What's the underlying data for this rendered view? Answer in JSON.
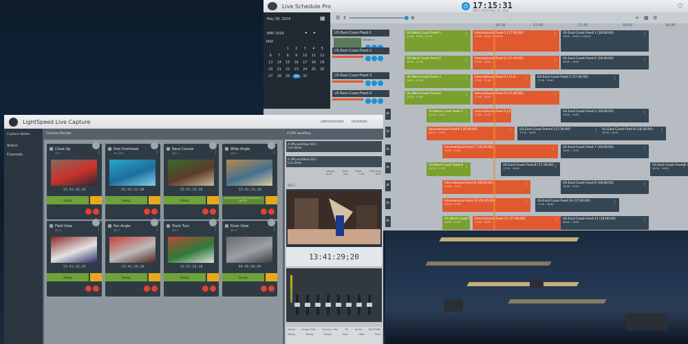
{
  "schedule_window": {
    "app_title": "Live Schedule Pro",
    "clock": "17:15:31",
    "clock_sub": "GMT+05:00   May 30, 2024",
    "side_date": "May 30, 2024",
    "month_label": "MAY 2024",
    "calendar_head": "MAY",
    "calendar_days": [
      "",
      "",
      "1",
      "2",
      "3",
      "4",
      "5",
      "6",
      "7",
      "8",
      "9",
      "10",
      "11",
      "12",
      "13",
      "14",
      "15",
      "16",
      "17",
      "18",
      "19",
      "20",
      "21",
      "22",
      "23",
      "24",
      "25",
      "26",
      "27",
      "28",
      "29",
      "30",
      "31"
    ],
    "selected_day": "30",
    "ticks": [
      "16:30",
      "17:00",
      "17:30",
      "18:00",
      "18:30",
      "19:00"
    ],
    "channels": [
      {
        "name": "US-East-Coast-Feed-1",
        "thumb_label": "Stitched 1"
      },
      {
        "name": "US-East-Coast-Feed-2"
      },
      {
        "name": "US-East-Coast-Feed-3"
      },
      {
        "name": "US-East-Coast-Feed-4"
      }
    ],
    "blocks": [
      {
        "title": "US-West-Coast-Feed-1",
        "meta": "17:00 - 16:30 | 11:30"
      },
      {
        "title": "International-Feed-1 (17:00:00)",
        "meta": "17:00 - 18:00 | 1:00:00"
      },
      {
        "title": "US-East-Coast-Feed-1 (18:00:00)",
        "meta": "18:00 - 19:00 | 1:00:00"
      },
      {
        "title": "US-West-Coast-Feed-2",
        "meta": "16:30 - 17:00"
      },
      {
        "title": "International-Feed-2 (17:00:00)",
        "meta": "17:00 - 18:00"
      },
      {
        "title": "US-East-Coast-Feed-2 (18:00:00)",
        "meta": "18:00 - 19:00"
      },
      {
        "title": "US-West-Coast-Feed-3",
        "meta": "16:30 - 17:00"
      },
      {
        "title": "International-Feed-3 (17:0...",
        "meta": "17:00 - 17:40"
      },
      {
        "title": "US-East-Coast-Feed-3 (17:40:00)",
        "meta": "17:40 - 18:40"
      },
      {
        "title": "US-West-Coast-Feed-4",
        "meta": "16:30 - 17:00"
      },
      {
        "title": "International-Feed-4 (17:00:00)",
        "meta": "17:00 - 18:00"
      },
      {
        "title": "US-West-Coast-Feed-5",
        "meta": "16:30 - 17:00"
      },
      {
        "title": "International-Feed-5 (17:00:00)",
        "meta": "17:00 - 17:30"
      },
      {
        "title": "US-East-Coast-Feed-5 (18:00:00)",
        "meta": "18:00 - 19:00"
      },
      {
        "title": "International-Feed-6 (16:30:00)",
        "meta": "16:30 - 17:30"
      },
      {
        "title": "US-East-Coast-Feed-6 (17:30:00)",
        "meta": "17:30 - 18:30"
      },
      {
        "title": "US-East-Coast-Feed-6 (18:30:00)",
        "meta": "18:30 - 19:30"
      },
      {
        "title": "International-Feed-7 (16:45:00)",
        "meta": "16:45 - 17:45"
      },
      {
        "title": "US-East-Coast-Feed-7 (18:00:00)",
        "meta": "18:00 - 19:00"
      },
      {
        "title": "US-West-Coast-Feed-8",
        "meta": "16:30 - 17:00"
      },
      {
        "title": "US-East-Coast-Feed-8 (17:30:00)",
        "meta": "17:30 - 18:00"
      },
      {
        "title": "US-East-Coast-Feed-8 (18:30:00)",
        "meta": "18:30 - 19:00"
      },
      {
        "title": "International-Feed-9 (16:45:00)",
        "meta": "16:45 - 17:45"
      },
      {
        "title": "US-East-Coast-Feed-9 (18:00:00)",
        "meta": "18:00 - 19:00"
      },
      {
        "title": "International-Feed-10 (16:45:00)",
        "meta": "16:45 - 17:45"
      },
      {
        "title": "US-East-Coast-Feed-10 (17:40:00)",
        "meta": "17:40 - 18:40"
      },
      {
        "title": "US-West-Coast-Feed-11",
        "meta": "16:30 - 17:00"
      },
      {
        "title": "International-Feed-11 (17:00:00)",
        "meta": "17:00 - 18:00"
      },
      {
        "title": "US-East-Coast-Feed-11 (18:00:00)",
        "meta": "18:00 - 19:00"
      }
    ]
  },
  "capture_window": {
    "app_title": "LightSpeed Live Capture",
    "user": "administrator",
    "host": "localhost",
    "sidebar_header": "Capture Nodes",
    "sidebar_items": [
      "Status",
      "Channels"
    ],
    "main_header": "Channel Monitor",
    "cards": [
      {
        "name": "Close Up",
        "sub": "SDI 1",
        "timecode": "13:41:29;18",
        "status": "Ready"
      },
      {
        "name": "Pool Overhead",
        "sub": "SM_UHD",
        "timecode": "01:42:32:08",
        "status": "Ready"
      },
      {
        "name": "Race Course",
        "sub": "SDI 3",
        "timecode": "13:41:29;18",
        "status": "Ready"
      },
      {
        "name": "Wide Angle",
        "sub": "SDI 4",
        "timecode": "13:41:29;18",
        "status": "Connecting to port localhost:1-80101"
      },
      {
        "name": "Field View",
        "sub": "SDI 1",
        "timecode": "13:41:29;18",
        "status": "Ready"
      },
      {
        "name": "Fan Angle",
        "sub": "SDI 2",
        "timecode": "13:41:29;18",
        "status": "Ready"
      },
      {
        "name": "Track Turn",
        "sub": "SDI 3",
        "timecode": "13:41:29;18",
        "status": "Ready"
      },
      {
        "name": "River View",
        "sub": "SDI 4",
        "timecode": "00:00:00;00",
        "status": "Ready"
      }
    ],
    "right_header": "4 UPS workflow",
    "workflows": [
      {
        "label": "4 UPS workflow",
        "detail": "SDI 1",
        "line2": "Live Show"
      },
      {
        "label": "4 UPS workflow",
        "detail": "SDI 1",
        "line2": "Live Show"
      }
    ],
    "table_headers": [
      "Loader",
      "Peak",
      "Peak",
      "Time Wav"
    ],
    "table_values": [
      "Shot",
      "Cap",
      "Cap",
      "Shot"
    ],
    "preview_label": "SDI 1",
    "preview_timecode": "13:41:29;20",
    "footer_headers": [
      "Signal",
      "Audio Hold",
      "Volume / Pan",
      "FA",
      "Audio",
      "FASTFIND"
    ],
    "footer_values": [
      "Ready",
      "Ready",
      "Ready",
      "Shot",
      "Hold",
      "Shot"
    ]
  },
  "colors": {
    "accent": "#1d8fd8",
    "green": "#7aa02f",
    "orange": "#e15a2f",
    "dark": "#344653",
    "status_green": "#6da23a",
    "status_yellow": "#e7a91c",
    "record_red": "#e44131"
  }
}
